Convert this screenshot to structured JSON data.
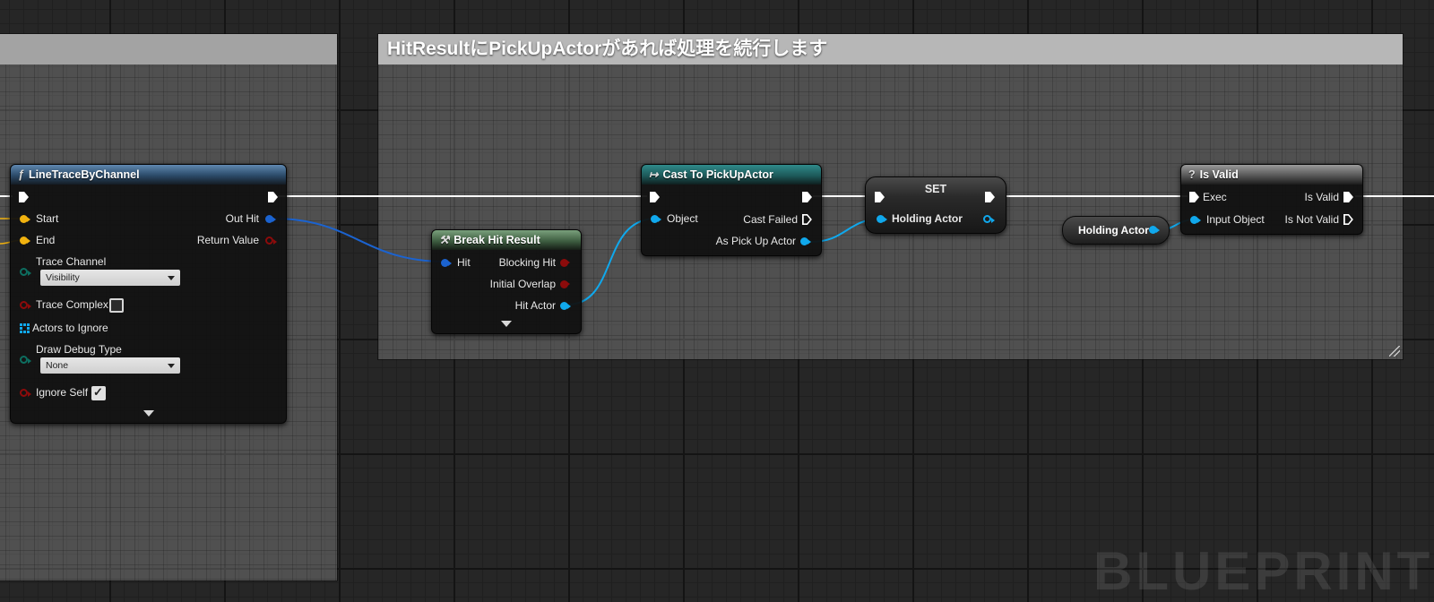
{
  "comment_right": {
    "title": "HitResultにPickUpActorがあれば処理を続行します"
  },
  "watermark": "BLUEPRINT",
  "line_trace": {
    "title": "LineTraceByChannel",
    "icon": "function-icon",
    "pins_in": {
      "start": "Start",
      "end": "End",
      "trace_channel": "Trace Channel",
      "trace_complex": "Trace Complex",
      "actors_to_ignore": "Actors to Ignore",
      "draw_debug_type": "Draw Debug Type",
      "ignore_self": "Ignore Self"
    },
    "pins_out": {
      "out_hit": "Out Hit",
      "return_value": "Return Value"
    },
    "trace_channel_value": "Visibility",
    "draw_debug_value": "None",
    "trace_complex_checked": false,
    "ignore_self_checked": true
  },
  "break_hit": {
    "title": "Break Hit Result",
    "pins_in": {
      "hit": "Hit"
    },
    "pins_out": {
      "blocking_hit": "Blocking Hit",
      "initial_overlap": "Initial Overlap",
      "hit_actor": "Hit Actor"
    }
  },
  "cast": {
    "title": "Cast To PickUpActor",
    "pins_in": {
      "object": "Object"
    },
    "pins_out": {
      "cast_failed": "Cast Failed",
      "as_pick_up_actor": "As Pick Up Actor"
    }
  },
  "set_node": {
    "title": "SET",
    "var": "Holding Actor"
  },
  "get_node": {
    "var": "Holding Actor"
  },
  "is_valid": {
    "title": "Is Valid",
    "pins_in": {
      "exec": "Exec",
      "input_object": "Input Object"
    },
    "pins_out": {
      "is_valid": "Is Valid",
      "is_not_valid": "Is Not Valid"
    }
  },
  "colors": {
    "exec_wire": "#ffffff",
    "struct_pin": "#1b63d0",
    "object_pin": "#10a8ec",
    "vector_pin": "#f1b20f",
    "bool_pin": "#8c0b0b",
    "byte_pin": "#0d6e60"
  }
}
